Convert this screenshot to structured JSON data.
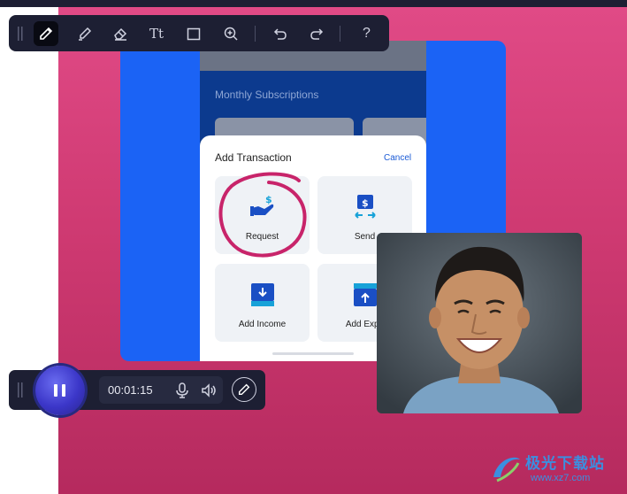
{
  "app": {
    "toolbar": {
      "tools": [
        {
          "name": "pen-tool",
          "icon": "pen-icon",
          "active": true
        },
        {
          "name": "highlighter-tool",
          "icon": "highlighter-icon",
          "active": false
        },
        {
          "name": "eraser-tool",
          "icon": "eraser-icon",
          "active": false
        },
        {
          "name": "text-tool",
          "icon": "text-icon",
          "label": "Tt",
          "active": false
        },
        {
          "name": "shape-tool",
          "icon": "rectangle-icon",
          "active": false
        },
        {
          "name": "zoom-tool",
          "icon": "zoom-in-icon",
          "active": false
        },
        {
          "name": "undo",
          "icon": "undo-icon",
          "active": false
        },
        {
          "name": "redo",
          "icon": "redo-icon",
          "active": false
        },
        {
          "name": "help",
          "icon": "help-icon",
          "label": "?",
          "active": false
        }
      ]
    },
    "recording": {
      "timer": "00:01:15",
      "state": "recording",
      "icons": [
        "pause-icon",
        "microphone-icon",
        "speaker-icon",
        "pen-icon"
      ]
    }
  },
  "phone": {
    "section_label": "Monthly Subscriptions",
    "sheet": {
      "title": "Add Transaction",
      "cancel": "Cancel",
      "tiles": [
        {
          "label": "Request",
          "icon": "request-money-icon"
        },
        {
          "label": "Send",
          "icon": "send-money-icon"
        },
        {
          "label": "Add Income",
          "icon": "add-income-icon"
        },
        {
          "label": "Add Expe",
          "icon": "add-expense-icon"
        }
      ]
    }
  },
  "annotation": {
    "type": "freehand-circle",
    "color": "#c8246a"
  },
  "webcam": {
    "content": "presenter-face-icon"
  },
  "watermark": {
    "main": "极光下载站",
    "sub": "www.xz7.com"
  },
  "colors": {
    "canvas_top": "#e04a86",
    "canvas_bottom": "#b52a5e",
    "toolbar_bg": "#1d1f33",
    "phone_blue": "#1b63f5",
    "phone_navy": "#0c3a8e",
    "accent_blue": "#1a5ad6",
    "pause_purple": "#3b36c8"
  }
}
